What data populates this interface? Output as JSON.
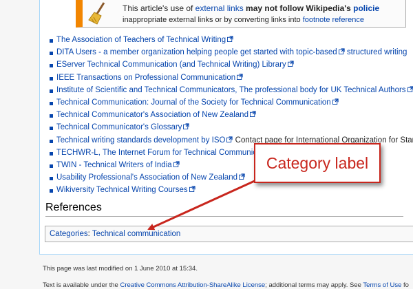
{
  "notice": {
    "line1_pre": "This article's use of ",
    "line1_link": "external links",
    "line1_bold": " may not follow Wikipedia's ",
    "line1_policy": "policie",
    "line2_pre": "inappropriate external links or by converting links into ",
    "line2_link": "footnote reference"
  },
  "links": [
    {
      "text": "The Association of Teachers of Technical Writing",
      "after": ""
    },
    {
      "text": "DITA Users - a member organization helping people get started with topic-based",
      "after": "structured writing",
      "after_is_link": true
    },
    {
      "text": "EServer Technical Communication (and Technical Writing) Library",
      "after": ""
    },
    {
      "text": "IEEE Transactions on Professional Communication",
      "after": ""
    },
    {
      "text": "Institute of Scientific and Technical Communicators, The professional body for UK Technical Authors",
      "after": ""
    },
    {
      "text": "Technical Communication: Journal of the Society for Technical Communication",
      "after": ""
    },
    {
      "text": "Technical Communicator's Association of New Zealand",
      "after": ""
    },
    {
      "text": "Technical Communicator's Glossary",
      "after": ""
    },
    {
      "text": "Technical writing standards development by ISO",
      "after": "Contact page for International Organization for Star",
      "after_is_link": false
    },
    {
      "text": "TECHWR-L, The Internet Forum for Technical Communic",
      "after": ""
    },
    {
      "text": "TWIN - Technical Writers of India",
      "after": ""
    },
    {
      "text": "Usability Professional's Association of New Zealand",
      "after": ""
    },
    {
      "text": "Wikiversity Technical Writing Courses",
      "after": ""
    }
  ],
  "references_heading": "References",
  "categories": {
    "label": "Categories",
    "sep": ": ",
    "item": "Technical communication"
  },
  "callout": {
    "text": "Category label",
    "color": "#c8261d"
  },
  "footer": {
    "last_modified": "This page was last modified on 1 June 2010 at 15:34.",
    "license_pre": "Text is available under the ",
    "license_link": "Creative Commons Attribution-ShareAlike License",
    "license_mid": "; additional terms may apply. See ",
    "license_terms": "Terms of Use",
    "license_post": " fo"
  },
  "colors": {
    "link": "#0645ad",
    "notice_bar": "#f28500",
    "content_border": "#a7d7f9"
  }
}
